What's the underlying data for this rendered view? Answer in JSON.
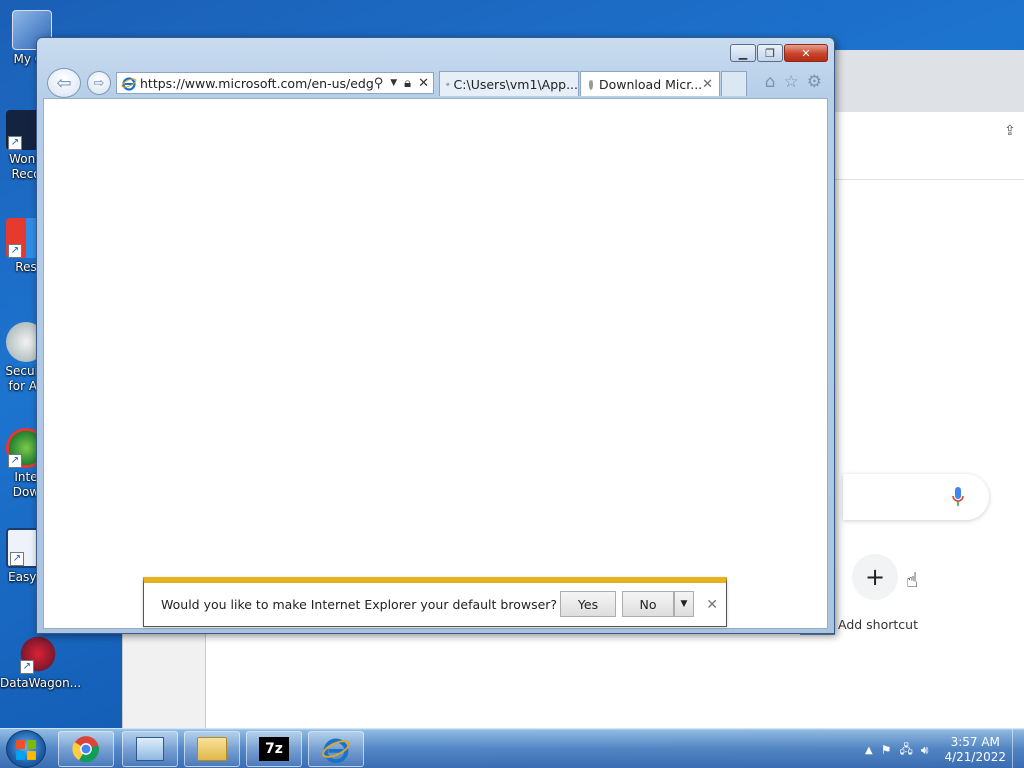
{
  "desktop": {
    "icons": [
      {
        "label": "My Co",
        "name": "my-computer"
      },
      {
        "label": "Wond\nReco",
        "name": "wondershare-recoverit"
      },
      {
        "label": "Res",
        "name": "restoro"
      },
      {
        "label": "Secure\nfor Ac",
        "name": "secure-for-access"
      },
      {
        "label": "Inte\nDow",
        "name": "internet-download-manager"
      },
      {
        "label": "EasyE",
        "name": "easy-app"
      },
      {
        "label": "DataWagon...",
        "name": "datawagon"
      }
    ]
  },
  "ie": {
    "address_url": "https://www.microsoft.com/en-us/edge",
    "tabs": [
      {
        "label": "C:\\Users\\vm1\\App...",
        "state": "inactive"
      },
      {
        "label": "Download Micr...",
        "state": "active-loading"
      }
    ],
    "notification": {
      "message": "Would you like to make Internet Explorer your default browser?",
      "yes_label": "Yes",
      "no_label": "No"
    }
  },
  "chrome_bg": {
    "add_shortcut_label": "Add shortcut"
  },
  "taskbar": {
    "pinned": [
      "chrome",
      "control-panel",
      "file-explorer",
      "7zip",
      "internet-explorer"
    ],
    "clock_time": "3:57 AM",
    "clock_date": "4/21/2022"
  },
  "colors": {
    "ie_accent": "#1a73c7",
    "notify_bar": "#e7b21d",
    "close_button": "#c7432a"
  }
}
